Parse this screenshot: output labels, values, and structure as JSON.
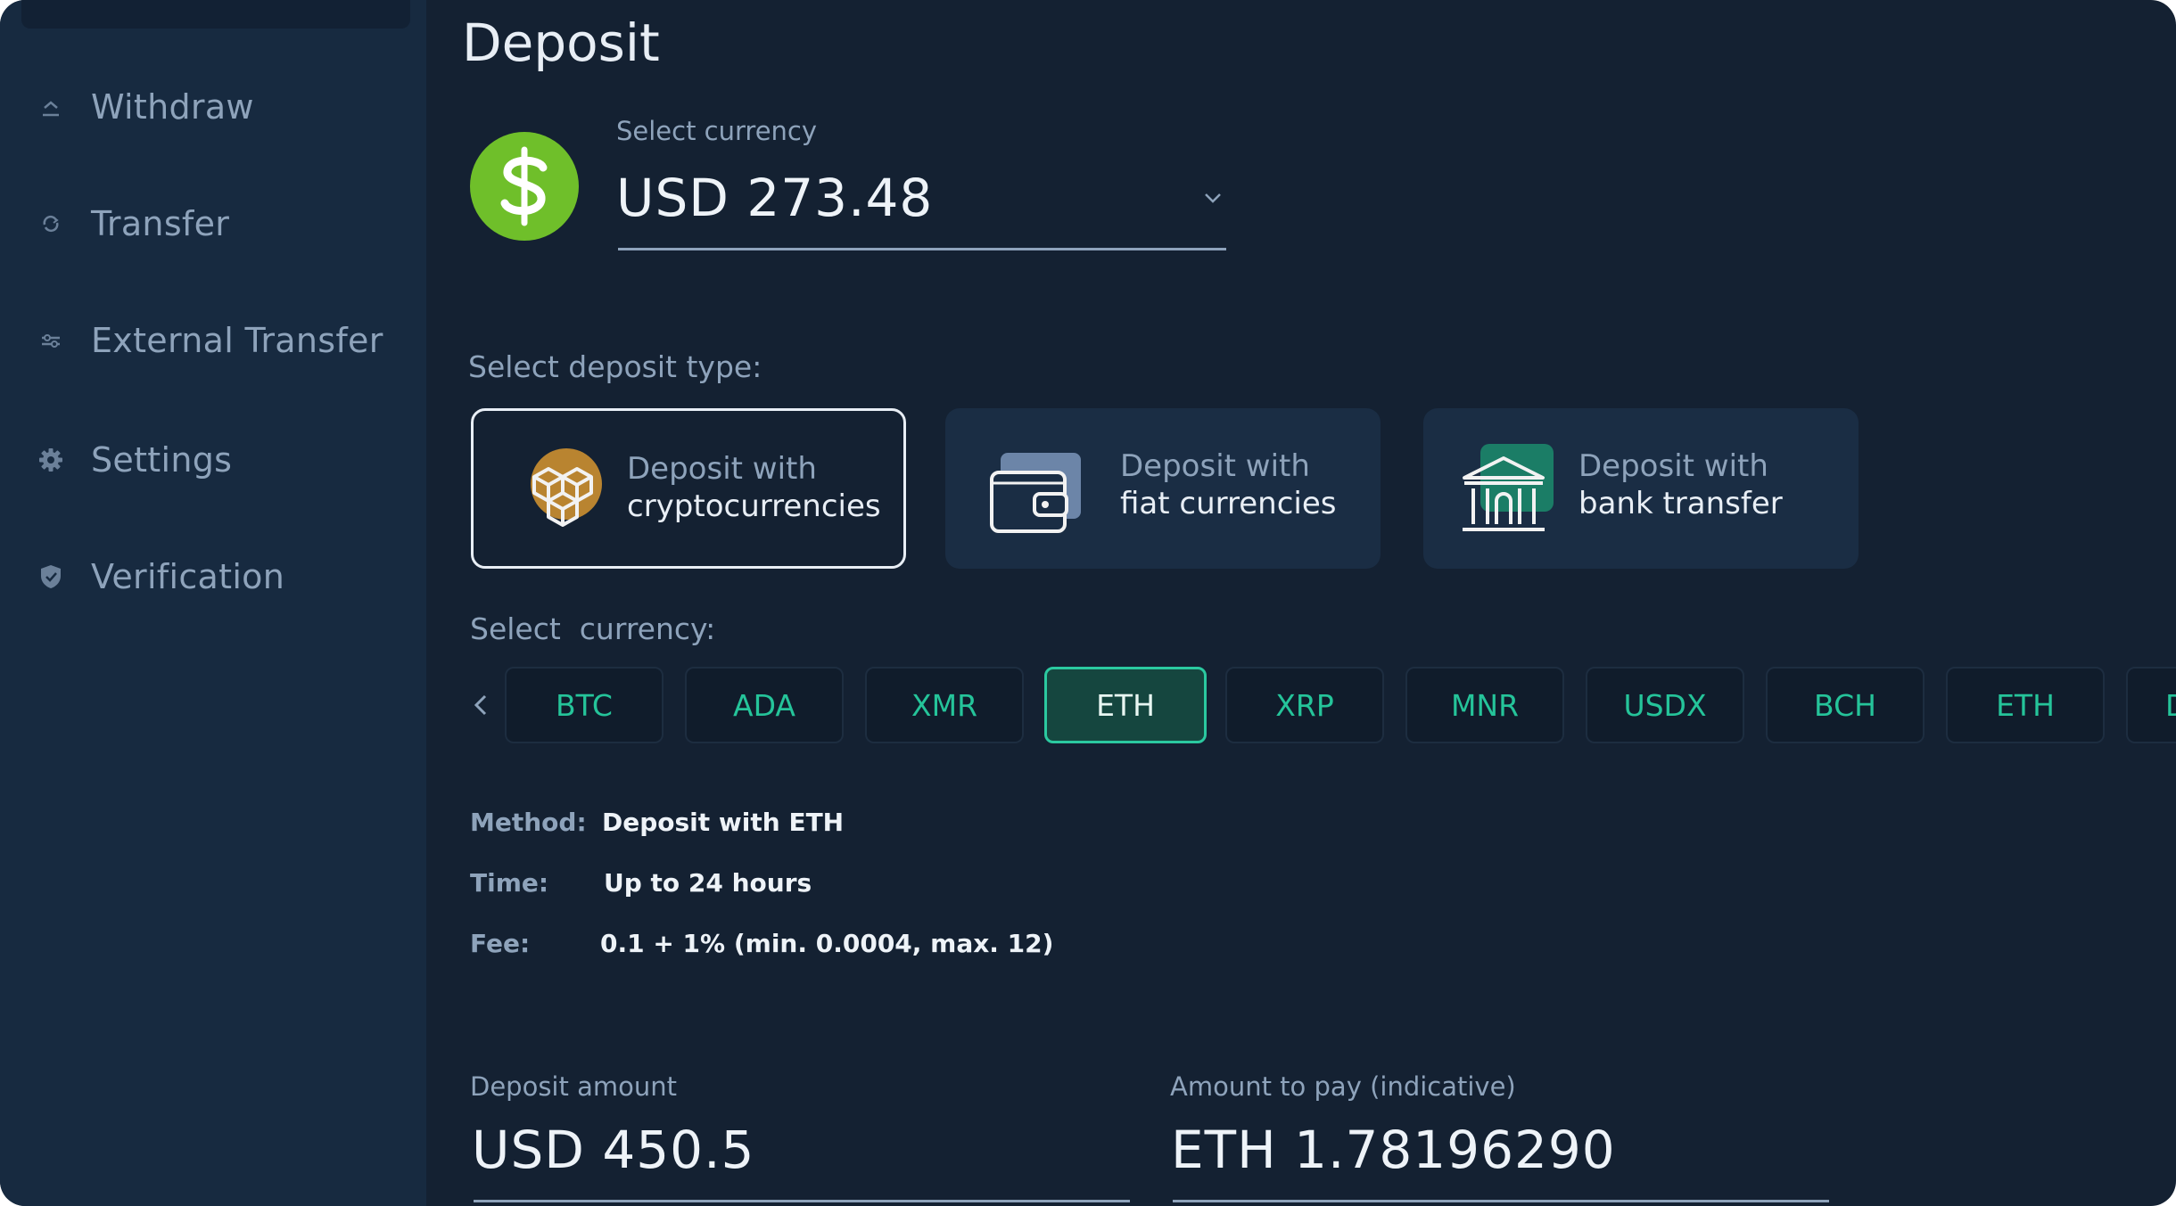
{
  "colors": {
    "background": "#142132",
    "sidebar": "#172a40",
    "accent": "#25c49a",
    "coin": "#6fbf2a"
  },
  "sidebar": {
    "items": [
      {
        "label": "Withdraw",
        "icon": "withdraw-icon"
      },
      {
        "label": "Transfer",
        "icon": "transfer-icon"
      },
      {
        "label": "External Transfer",
        "icon": "external-transfer-icon"
      },
      {
        "label": "Settings",
        "icon": "gear-icon"
      },
      {
        "label": "Verification",
        "icon": "shield-icon"
      }
    ]
  },
  "main": {
    "title": "Deposit",
    "currency_select": {
      "label": "Select currency",
      "value": "USD 273.48",
      "icon": "dollar-coin-icon"
    },
    "deposit_type_label": "Select deposit type:",
    "deposit_types": [
      {
        "line1": "Deposit with",
        "line2": "cryptocurrencies",
        "icon": "crypto-cubes-icon",
        "selected": true
      },
      {
        "line1": "Deposit with",
        "line2": "fiat currencies",
        "icon": "wallet-icon",
        "selected": false
      },
      {
        "line1": "Deposit with",
        "line2": "bank transfer",
        "icon": "bank-icon",
        "selected": false
      }
    ],
    "currency_label": "Select  currency:",
    "currencies": [
      "BTC",
      "ADA",
      "XMR",
      "ETH",
      "XRP",
      "MNR",
      "USDX",
      "BCH",
      "ETH",
      "D"
    ],
    "selected_currency_index": 3,
    "info": {
      "method_key": "Method:",
      "method_value": "Deposit with ETH",
      "time_key": "Time:",
      "time_value": "Up to 24 hours",
      "fee_key": "Fee:",
      "fee_value": "0.1 + 1% (min. 0.0004, max. 12)"
    },
    "deposit_amount": {
      "label": "Deposit amount",
      "value": "USD 450.5"
    },
    "amount_to_pay": {
      "label": "Amount to pay (indicative)",
      "value": "ETH 1.78196290"
    }
  }
}
